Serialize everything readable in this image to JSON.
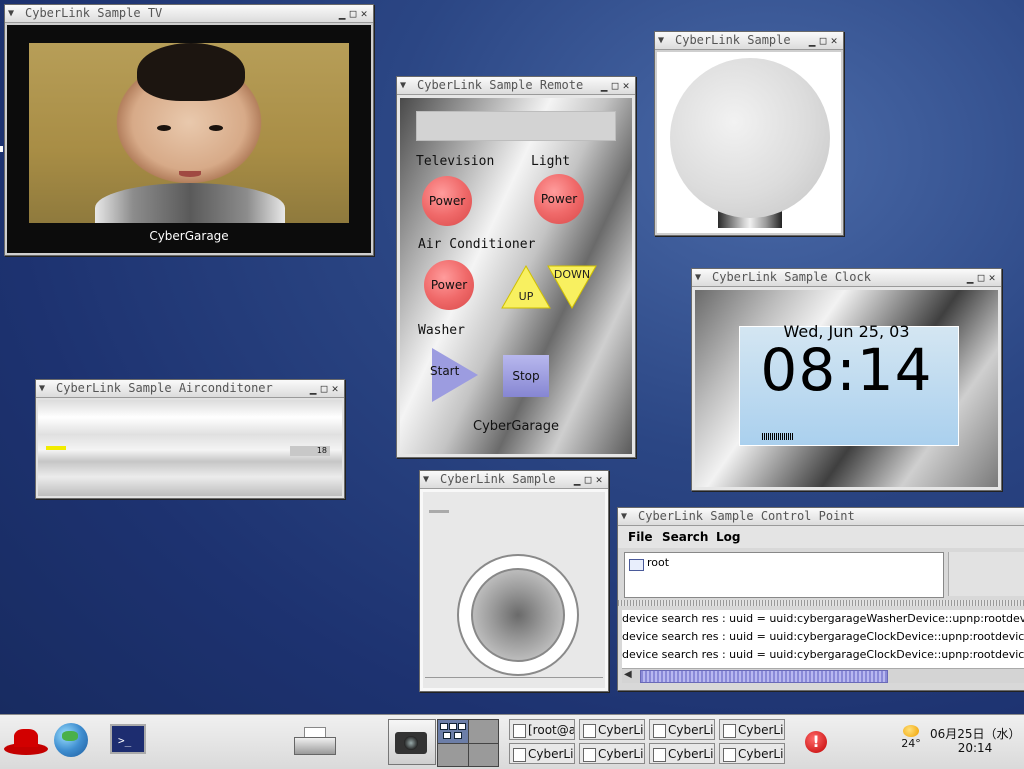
{
  "windows": {
    "tv": {
      "title": "CyberLink Sample TV",
      "caption": "CyberGarage"
    },
    "remote": {
      "title": "CyberLink Sample Remote",
      "television_label": "Television",
      "light_label": "Light",
      "power_label": "Power",
      "aircon_label": "Air Conditioner",
      "up_label": "UP",
      "down_label": "DOWN",
      "washer_label": "Washer",
      "start_label": "Start",
      "stop_label": "Stop",
      "brand": "CyberGarage"
    },
    "light": {
      "title": "CyberLink Sample"
    },
    "clock": {
      "title": "CyberLink Sample Clock",
      "date": "Wed, Jun 25, 03",
      "time": "08:14"
    },
    "aircon": {
      "title": "CyberLink Sample Airconditoner",
      "temperature": "18"
    },
    "washer": {
      "title": "CyberLink Sample"
    },
    "control_point": {
      "title": "CyberLink Sample Control Point",
      "menu": [
        "File",
        "Search",
        "Log"
      ],
      "tree_root": "root",
      "log_lines": [
        "device search res : uuid = uuid:cybergarageWasherDevice::upnp:rootdevice",
        "device search res : uuid = uuid:cybergarageClockDevice::upnp:rootdevice",
        "device search res : uuid = uuid:cybergarageClockDevice::upnp:rootdevice"
      ]
    }
  },
  "taskbar": {
    "tasks": [
      "[root@a",
      "CyberLi",
      "CyberLi",
      "CyberLi",
      "CyberLi",
      "CyberLi",
      "CyberLi",
      "CyberLi"
    ],
    "weather_temp": "24°",
    "date": "06月25日（水）",
    "time": "20:14",
    "alert_symbol": "!"
  },
  "icons": {
    "window_menu": "chevron-down-icon",
    "minimize": "minimize-icon",
    "maximize": "maximize-icon",
    "close": "close-icon"
  },
  "colors": {
    "desktop": "#1d3270",
    "power_button": "#f06a6a",
    "up_down": "#f8f060",
    "start_stop": "#9c9ce0",
    "aircon_indicator": "#f2ec00",
    "scroll_thumb": "#8a8ad8"
  }
}
